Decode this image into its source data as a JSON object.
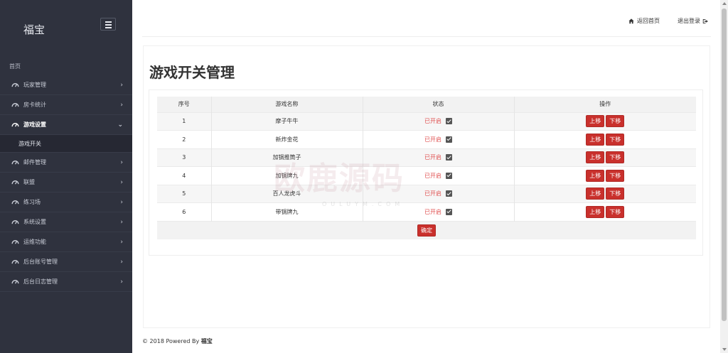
{
  "brand": "福宝",
  "section_label": "首页",
  "sidebar": {
    "items": [
      {
        "label": "玩家管理",
        "icon": "gauge-icon",
        "expanded": false
      },
      {
        "label": "房卡统计",
        "icon": "gauge-icon",
        "expanded": false
      },
      {
        "label": "游戏设置",
        "icon": "gauge-icon",
        "expanded": true
      },
      {
        "label": "邮件管理",
        "icon": "gauge-icon",
        "expanded": false
      },
      {
        "label": "联盟",
        "icon": "gauge-icon",
        "expanded": false
      },
      {
        "label": "练习场",
        "icon": "gauge-icon",
        "expanded": false
      },
      {
        "label": "系统设置",
        "icon": "gauge-icon",
        "expanded": false
      },
      {
        "label": "运维功能",
        "icon": "gauge-icon",
        "expanded": false
      },
      {
        "label": "后台账号管理",
        "icon": "gauge-icon",
        "expanded": false
      },
      {
        "label": "后台日志管理",
        "icon": "gauge-icon",
        "expanded": false
      }
    ],
    "sub_item": "游戏开关"
  },
  "header": {
    "home_label": "返回首页",
    "logout_label": "退出登录"
  },
  "page_title": "游戏开关管理",
  "table": {
    "headers": [
      "序号",
      "游戏名称",
      "状态",
      "操作"
    ],
    "rows": [
      {
        "no": "1",
        "name": "摩子牛牛",
        "status": "已开启",
        "checked": true
      },
      {
        "no": "2",
        "name": "新炸金花",
        "status": "已开启",
        "checked": true
      },
      {
        "no": "3",
        "name": "加锅推筒子",
        "status": "已开启",
        "checked": true
      },
      {
        "no": "4",
        "name": "加锅牌九",
        "status": "已开启",
        "checked": true
      },
      {
        "no": "5",
        "name": "百人龙虎斗",
        "status": "已开启",
        "checked": true
      },
      {
        "no": "6",
        "name": "带锅牌九",
        "status": "已开启",
        "checked": true
      }
    ],
    "up_label": "上移",
    "down_label": "下移",
    "confirm_label": "确定"
  },
  "footer": {
    "prefix": "© 2018 Powered By ",
    "brand": "福宝"
  },
  "watermark": {
    "main": "欧鹿源码",
    "sub": "OULUYM.COM"
  },
  "colors": {
    "sidebar_bg": "#2f323e",
    "accent_red": "#c9302c",
    "status_red": "#e05050"
  }
}
